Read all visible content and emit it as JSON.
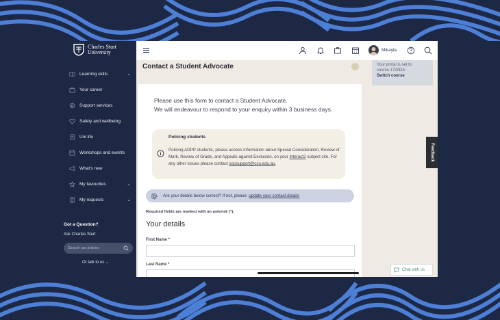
{
  "brand": {
    "name_line1": "Charles Sturt",
    "name_line2": "University"
  },
  "sidebar": {
    "items": [
      {
        "label": "Learning skills",
        "icon": "book-icon",
        "chevron": "⌄"
      },
      {
        "label": "Your career",
        "icon": "briefcase-icon"
      },
      {
        "label": "Support services",
        "icon": "support-icon"
      },
      {
        "label": "Safety and wellbeing",
        "icon": "heart-icon"
      },
      {
        "label": "Uni life",
        "icon": "document-icon"
      },
      {
        "label": "Workshops and events",
        "icon": "calendar-icon"
      },
      {
        "label": "What's new",
        "icon": "megaphone-icon"
      },
      {
        "label": "My favourites",
        "icon": "star-icon",
        "chevron": "⌄"
      },
      {
        "label": "My requests",
        "icon": "list-icon",
        "chevron": "⌄"
      }
    ],
    "question_title": "Got a Question?",
    "ask_label": "Ask Charles Sturt",
    "search_placeholder": "Search our articles",
    "talk_label": "Or talk to us ⌄"
  },
  "topbar": {
    "user_name": "Mikayla"
  },
  "page": {
    "title": "Contact a Student Advocate",
    "portal_line1": "Your portal is set to",
    "portal_line2": "course 1720DA",
    "switch_course": "Switch course",
    "intro_line1": "Please use this form to contact a Student Advocate.",
    "intro_line2": "We will endeavour to respond to your enquiry within 3 business days.",
    "notice": {
      "title": "Policing students",
      "body_before_link": "Policing ADPP students, please access information about Special Consideration, Review of Mark, Review of Grade, and Appeals against Exclusion, on your ",
      "link1": "Interact2",
      "body_mid": " subject site. For any other issues please contact ",
      "link2": "sopsupport@csu.edu.au",
      "body_end": "."
    },
    "verify_text": "Are your details below correct? If not, please",
    "verify_link": "update your contact details",
    "required_text": "Required fields are marked with an asterisk (*).",
    "section_title": "Your details",
    "first_name_label": "First Name *",
    "last_name_label": "Last Name *"
  },
  "feedback_label": "Feedback",
  "chat_label": "Chat with us",
  "colors": {
    "navy": "#1d2845",
    "decor_blue": "#4d7fd6",
    "beige": "#efeae3"
  }
}
